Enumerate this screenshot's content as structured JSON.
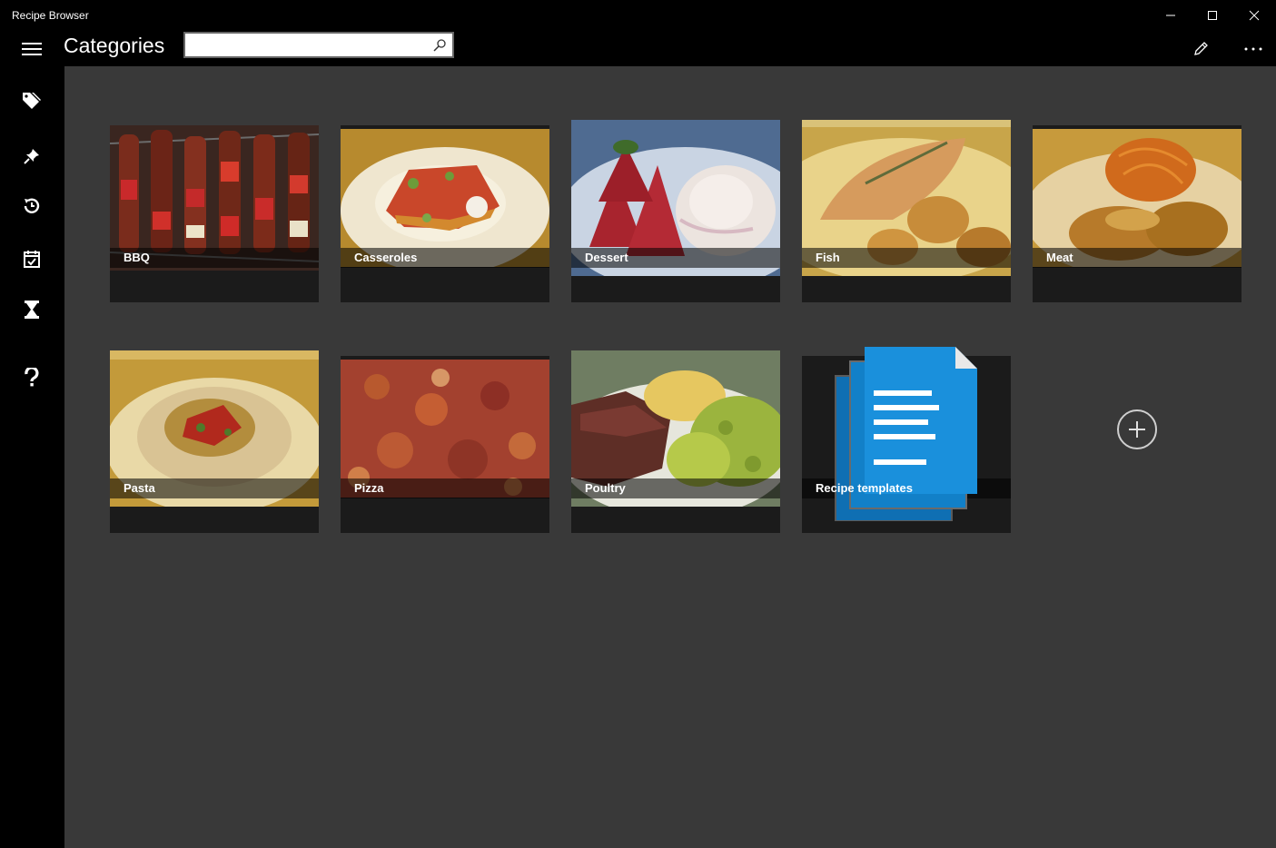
{
  "window": {
    "title": "Recipe Browser"
  },
  "appbar": {
    "page_title": "Categories",
    "search": {
      "value": "",
      "placeholder": ""
    }
  },
  "sidebar": {
    "items": [
      {
        "icon": "tags-icon"
      },
      {
        "icon": "pin-icon"
      },
      {
        "icon": "history-icon"
      },
      {
        "icon": "calendar-check-icon"
      },
      {
        "icon": "hourglass-icon"
      },
      {
        "icon": "help-icon"
      }
    ]
  },
  "categories": [
    {
      "label": "BBQ"
    },
    {
      "label": "Casseroles"
    },
    {
      "label": "Dessert"
    },
    {
      "label": "Fish"
    },
    {
      "label": "Meat"
    },
    {
      "label": "Pasta"
    },
    {
      "label": "Pizza"
    },
    {
      "label": "Poultry"
    },
    {
      "label": "Recipe templates"
    }
  ],
  "colors": {
    "accent": "#1a8ad4",
    "content_bg": "#393939",
    "tile_bg": "#1b1b1b"
  }
}
